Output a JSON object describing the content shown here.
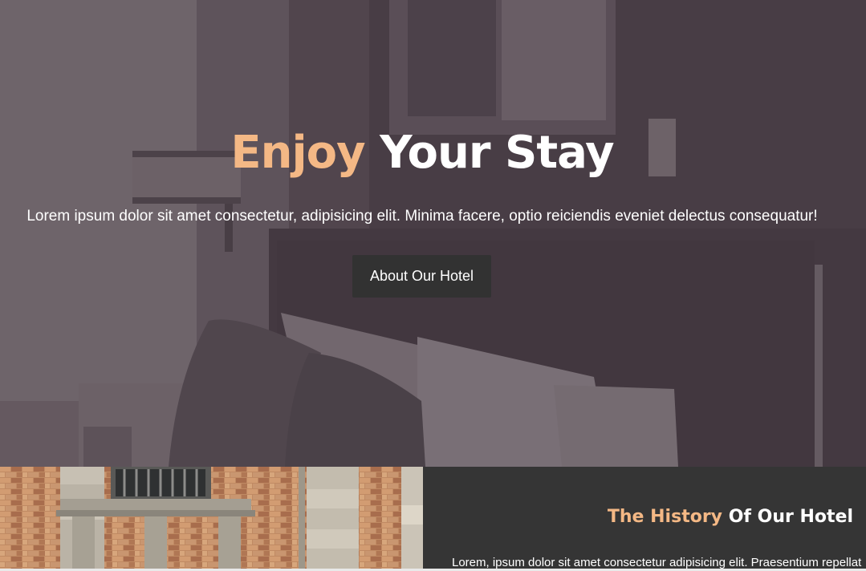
{
  "hero": {
    "title_accent": "Enjoy",
    "title_rest": "Your Stay",
    "subtitle": "Lorem ipsum dolor sit amet consectetur, adipisicing elit. Minima facere, optio reiciendis eveniet delectus consequatur!",
    "button_label": "About Our Hotel"
  },
  "history": {
    "title_accent": "The History",
    "title_rest": "Of Our Hotel",
    "text": "Lorem, ipsum dolor sit amet consectetur adipisicing elit. Praesentium repellat"
  },
  "colors": {
    "accent": "#f4b885",
    "button_bg": "#323232",
    "panel_bg": "#353535",
    "overlay": "#4d434a"
  }
}
